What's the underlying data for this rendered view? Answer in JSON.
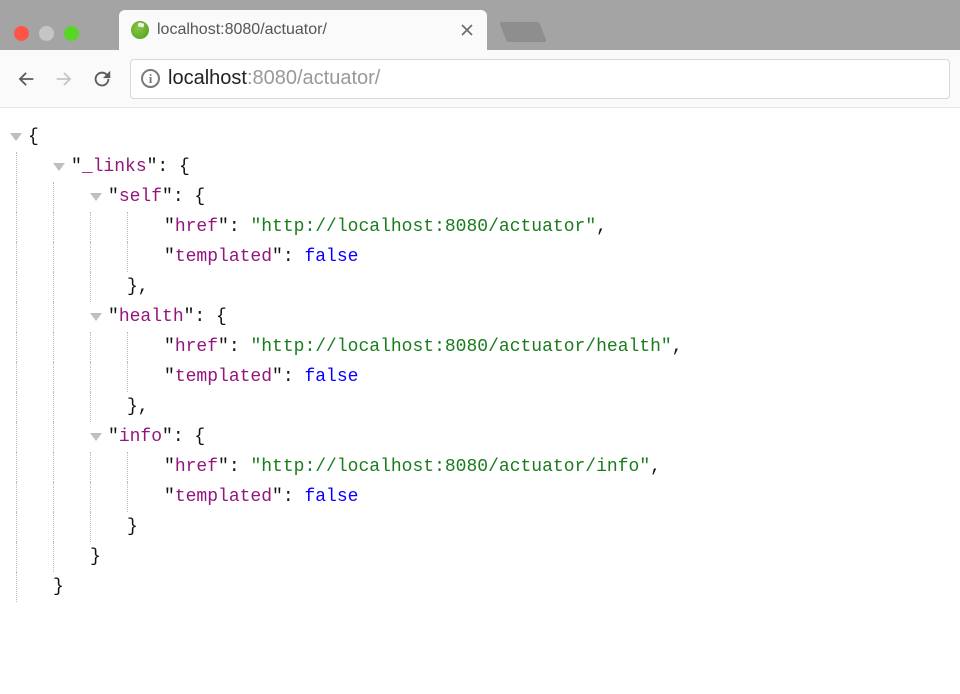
{
  "browser": {
    "tab_title": "localhost:8080/actuator/",
    "url_host": "localhost",
    "url_path": ":8080/actuator/"
  },
  "json": {
    "root_key": "_links",
    "entries": [
      {
        "name": "self",
        "href_key": "href",
        "href_value": "http://localhost:8080/actuator",
        "templated_key": "templated",
        "templated_value": "false"
      },
      {
        "name": "health",
        "href_key": "href",
        "href_value": "http://localhost:8080/actuator/health",
        "templated_key": "templated",
        "templated_value": "false"
      },
      {
        "name": "info",
        "href_key": "href",
        "href_value": "http://localhost:8080/actuator/info",
        "templated_key": "templated",
        "templated_value": "false"
      }
    ]
  }
}
